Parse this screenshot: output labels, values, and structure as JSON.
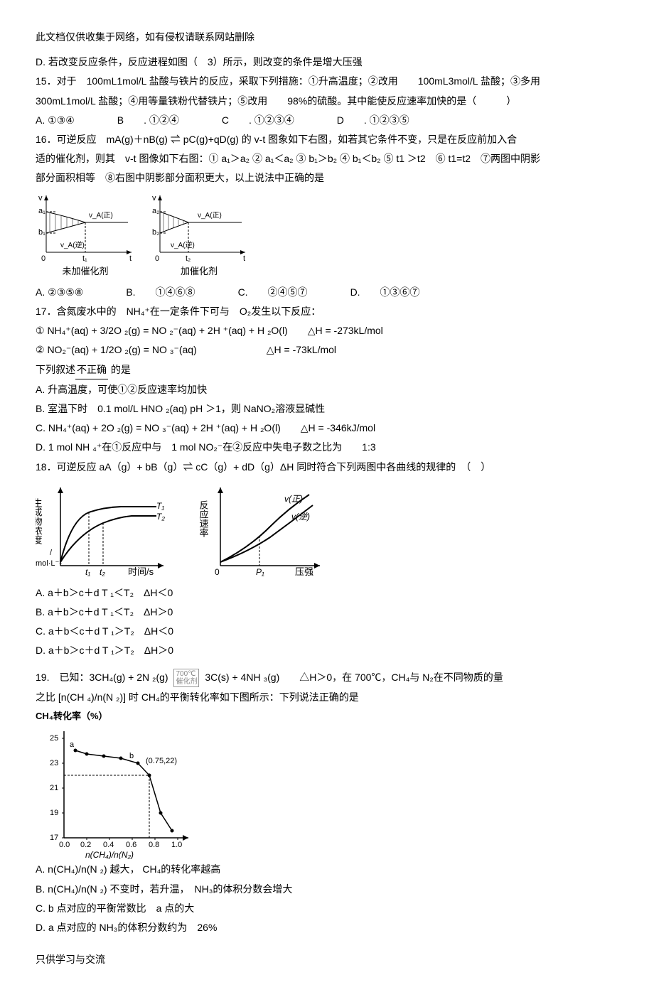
{
  "header_note": "此文档仅供收集于网络，如有侵权请联系网站删除",
  "footer_note": "只供学习与交流",
  "q14d": "D.  若改变反应条件，反应进程如图（　3）所示，则改变的条件是增大压强",
  "q15": {
    "stem1": "15．对于　100mL1mol/L 盐酸与铁片的反应，采取下列措施：①升高温度；②改用　　100mL3mol/L 盐酸；③多用",
    "stem2": "300mL1mol/L 盐酸；④用等量铁粉代替铁片；⑤改用　　98%的硫酸。其中能使反应速率加快的是（　　　）",
    "A": "A.  ①③④",
    "B": "B　　. ①②④",
    "C": "C　　. ①②③④",
    "D": "D　　. ①②③⑤"
  },
  "q16": {
    "stem1": "16．可逆反应　mA(g)＋nB(g) ⇌ pC(g)+qD(g)  的 v-t  图象如下右图，如若其它条件不变，只是在反应前加入合",
    "stem2": "适的催化剂，则其　v-t  图像如下右图：① a₁＞a₂ ② a₁＜a₂ ③ b₁＞b₂ ④ b₁＜b₂ ⑤ t1 ＞t2　⑥ t1=t2　⑦两图中阴影",
    "stem3": "部分面积相等　⑧右图中阴影部分面积更大，以上说法中正确的是",
    "fig1_cap": "未加催化剂",
    "fig2_cap": "加催化剂",
    "A": "A. ②③⑤⑧",
    "B": "B.　　①④⑥⑧",
    "C": "C.　　②④⑤⑦",
    "D": "D.　　①③⑥⑦"
  },
  "q17": {
    "stem1": "17．含氮废水中的　NH₄⁺在一定条件下可与　O₂发生以下反应：",
    "eq1": "①  NH₄⁺(aq) + 3/2O ₂(g) = NO ₂⁻(aq) + 2H ⁺(aq) + H ₂O(l)　　△H = -273kL/mol",
    "eq2": "②  NO₂⁻(aq) + 1/2O ₂(g) = NO ₃⁻(aq)　　　　　　　△H = -73kL/mol",
    "stem2": "下列叙述不正确 的是",
    "A": "A.  升高温度，可使①②反应速率均加快",
    "B": "B.  室温下时　0.1 mol/L HNO ₂(aq) pH ＞1，则 NaNO₂溶液显碱性",
    "C": "C.  NH₄⁺(aq) + 2O ₂(g) = NO ₃⁻(aq) + 2H ⁺(aq) + H ₂O(l)　　△H = -346kJ/mol",
    "D": "D.  1 mol NH ₄⁺在①反应中与　1 mol NO₂⁻在②反应中失电子数之比为　　1:3"
  },
  "q18": {
    "stem": "18．可逆反应  aA（g）+ bB（g）⇌ cC（g）+ dD（g）ΔH  同时符合下列两图中各曲线的规律的　（　）",
    "A": "A.  a＋b＞c＋d T ₁＜T₂　ΔH＜0",
    "B": "B.  a＋b＞c＋d T ₁＜T₂　ΔH＞0",
    "C": "C.  a＋b＜c＋d T ₁＞T₂　ΔH＜0",
    "D": "D.  a＋b＞c＋d T ₁＞T₂　ΔH＞0"
  },
  "q19": {
    "stem1_a": "19.　已知：3CH₄(g) + 2N ₂(g)",
    "cond_top": "700℃",
    "cond_bot": "催化剂",
    "stem1_b": "3C(s) + 4NH ₃(g)　　△H＞0，在 700℃，CH₄与 N₂在不同物质的量",
    "stem2": "之比 [n(CH ₄)/n(N ₂)]  时 CH₄的平衡转化率如下图所示：下列说法正确的是",
    "chart_title": "CH₄转化率（%）",
    "A": "A.  n(CH₄)/n(N ₂) 越大，  CH₄的转化率越高",
    "B": "B.  n(CH₄)/n(N ₂) 不变时，若升温，　NH₃的体积分数会增大",
    "C": "C.  b 点对应的平衡常数比　a 点的大",
    "D": "D.  a 点对应的  NH₃的体积分数约为　26%"
  },
  "chart_data": [
    {
      "type": "line",
      "caption": "未加催化剂",
      "series": [
        {
          "name": "v_A(正)",
          "start_y": "a₁",
          "end_y": "equilibrium"
        },
        {
          "name": "v_A(逆)",
          "start_y": "b₁",
          "end_y": "equilibrium"
        }
      ],
      "xlabel": "t",
      "ylabel": "v",
      "x_mark": "t₁"
    },
    {
      "type": "line",
      "caption": "加催化剂",
      "series": [
        {
          "name": "v_A(正)",
          "start_y": "a₂",
          "end_y": "equilibrium"
        },
        {
          "name": "v_A(逆)",
          "start_y": "b₂",
          "end_y": "equilibrium"
        }
      ],
      "xlabel": "t",
      "ylabel": "v",
      "x_mark": "t₂"
    },
    {
      "type": "line",
      "xlabel": "时间/s",
      "ylabel": "生成物浓度/ mol·L⁻¹",
      "series": [
        {
          "name": "T₁"
        },
        {
          "name": "T₂"
        }
      ],
      "x_marks": [
        "t₁",
        "t₂"
      ]
    },
    {
      "type": "line",
      "xlabel": "压强",
      "ylabel": "反应速率",
      "series": [
        {
          "name": "v(正)"
        },
        {
          "name": "v(逆)"
        }
      ],
      "x_marks": [
        "P₁"
      ]
    },
    {
      "type": "line",
      "title": "CH₄转化率（%）",
      "xlabel": "n(CH₄)/n(N₂)",
      "x": [
        0.1,
        0.2,
        0.35,
        0.5,
        0.65,
        0.75,
        0.85,
        0.95
      ],
      "y": [
        24.0,
        23.7,
        23.5,
        23.2,
        22.8,
        22.0,
        19.0,
        17.5
      ],
      "annotations": [
        {
          "label": "a",
          "x": 0.1,
          "y": 24.0
        },
        {
          "label": "b",
          "x": 0.65,
          "y": 22.8
        },
        {
          "label": "(0.75,22)",
          "x": 0.75,
          "y": 22.0
        }
      ],
      "xlim": [
        0.0,
        1.0
      ],
      "ylim": [
        17,
        25
      ],
      "xticks": [
        0.0,
        0.2,
        0.4,
        0.6,
        0.8,
        1.0
      ],
      "yticks": [
        17,
        19,
        21,
        23,
        25
      ]
    }
  ]
}
